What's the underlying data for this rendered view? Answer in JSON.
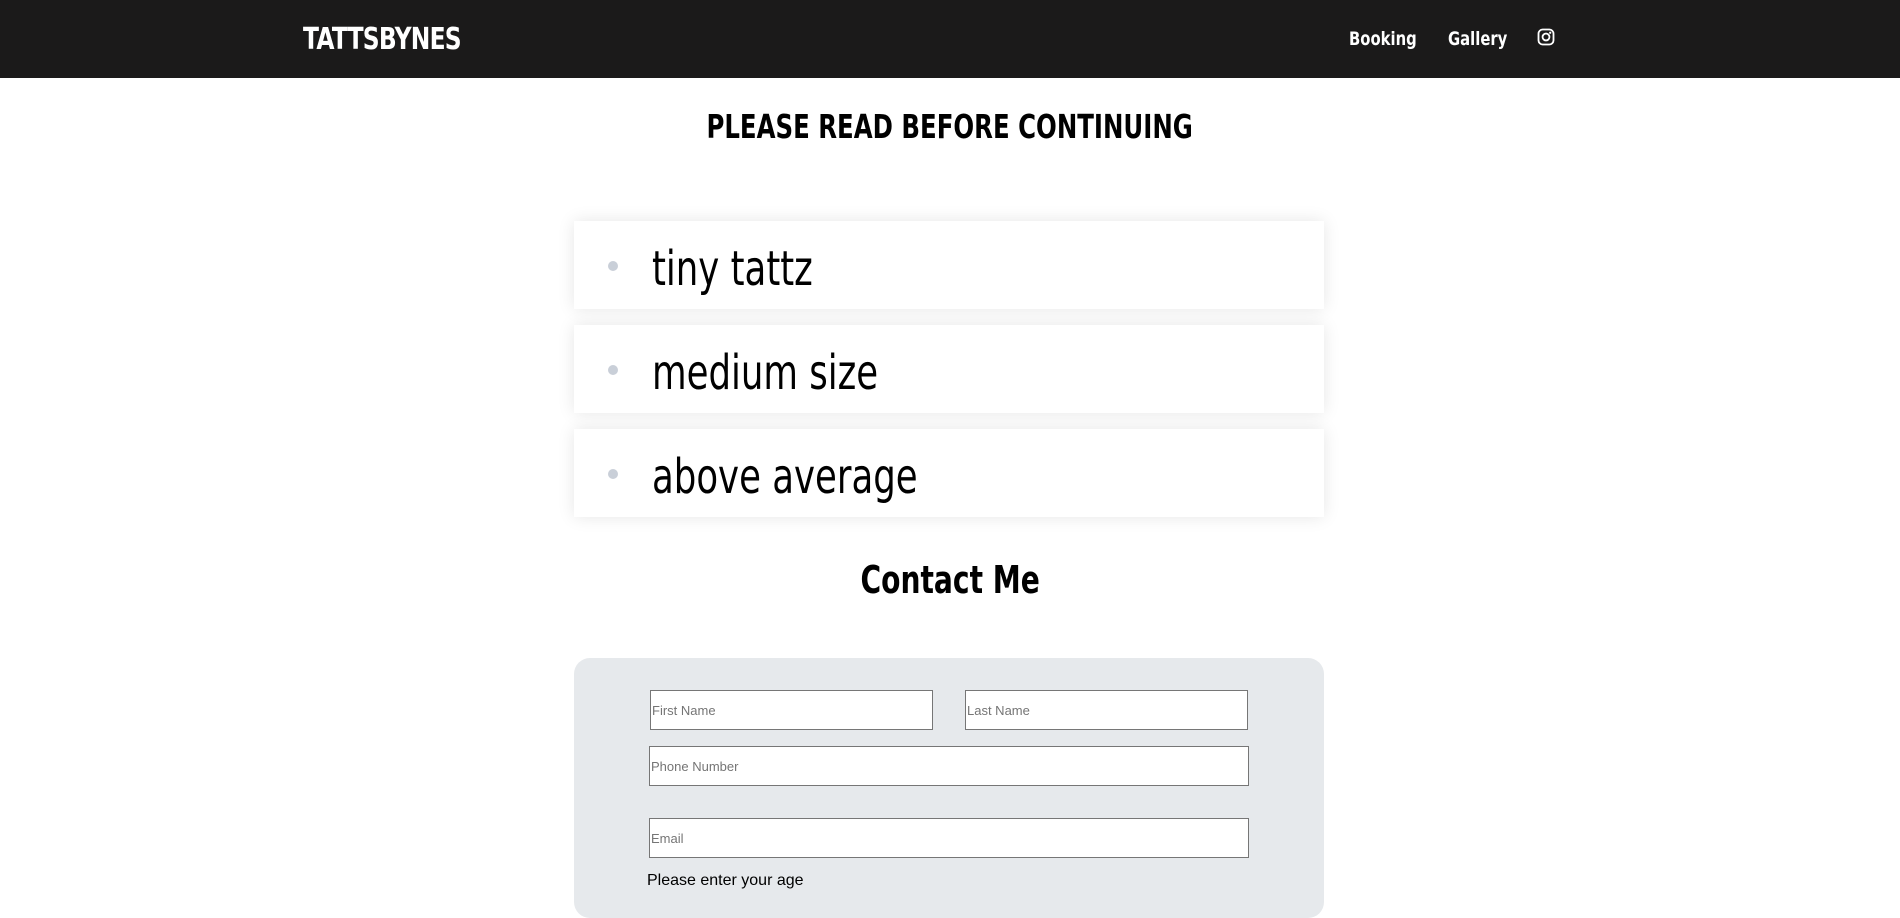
{
  "navbar": {
    "brand": "TATTSBYNES",
    "links": [
      {
        "label": "Booking"
      },
      {
        "label": "Gallery"
      }
    ],
    "instagram_icon": "instagram-icon",
    "background_color": "#1b1a1a"
  },
  "notice": {
    "heading": "PLEASE READ BEFORE CONTINUING",
    "options": [
      {
        "label": "tiny tattz"
      },
      {
        "label": "medium size"
      },
      {
        "label": "above average"
      }
    ]
  },
  "contact": {
    "heading": "Contact Me",
    "panel_color": "#e6e9ec",
    "fields": {
      "first_name": {
        "placeholder": "First Name",
        "value": ""
      },
      "last_name": {
        "placeholder": "Last Name",
        "value": ""
      },
      "phone": {
        "placeholder": "Phone Number",
        "value": ""
      },
      "email": {
        "placeholder": "Email",
        "value": ""
      }
    },
    "age_label": "Please enter your age"
  }
}
